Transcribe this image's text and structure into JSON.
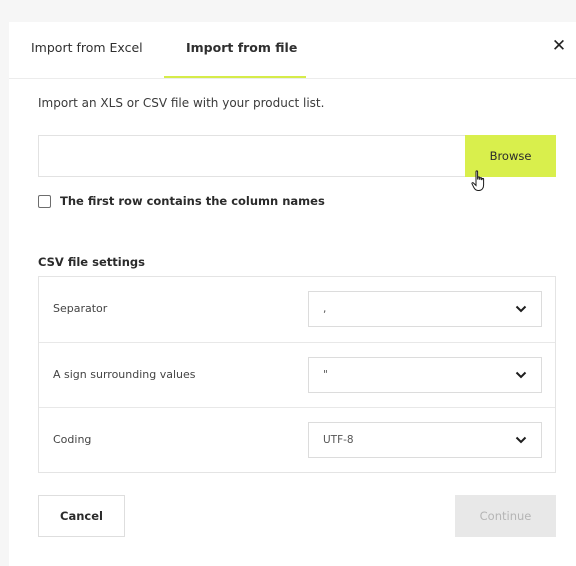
{
  "tabs": [
    {
      "label": "Import from Excel",
      "active": false
    },
    {
      "label": "Import from file",
      "active": true
    }
  ],
  "close_icon": "close-icon",
  "intro": "Import an XLS or CSV file with your product list.",
  "file": {
    "value": "",
    "browse_label": "Browse"
  },
  "first_row_checkbox": {
    "label": "The first row contains the column names",
    "checked": false
  },
  "csv_settings": {
    "title": "CSV file settings",
    "rows": [
      {
        "label": "Separator",
        "value": ","
      },
      {
        "label": "A sign surrounding values",
        "value": "\""
      },
      {
        "label": "Coding",
        "value": "UTF-8"
      }
    ]
  },
  "actions": {
    "cancel": "Cancel",
    "continue": "Continue"
  },
  "colors": {
    "accent": "#d9ef4c",
    "disabled_bg": "#e8e8e8",
    "disabled_text": "#b5b5b5"
  }
}
